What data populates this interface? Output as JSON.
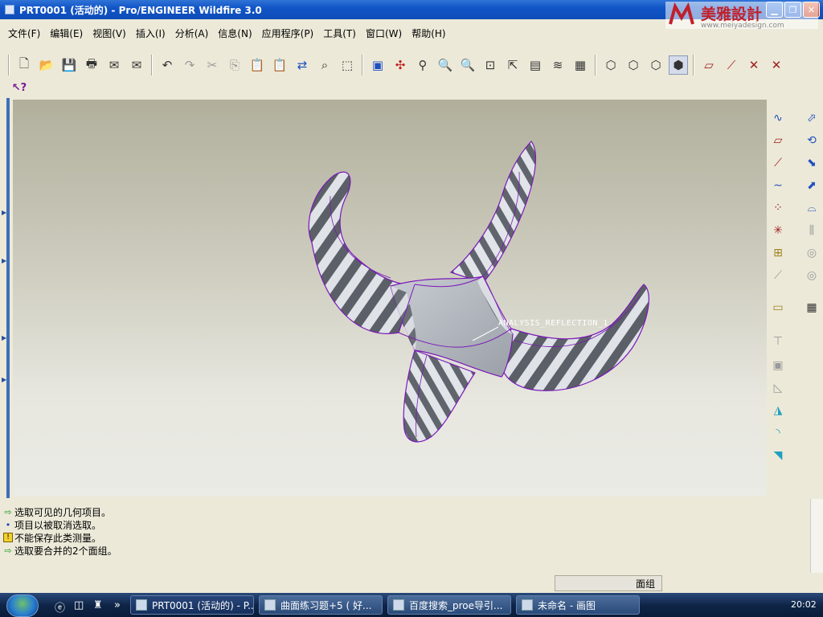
{
  "window": {
    "title": "PRT0001 (活动的) - Pro/ENGINEER Wildfire 3.0",
    "minimize": "▁",
    "restore": "❐",
    "close": "✕"
  },
  "menu": [
    "文件(F)",
    "编辑(E)",
    "视图(V)",
    "插入(I)",
    "分析(A)",
    "信息(N)",
    "应用程序(P)",
    "工具(T)",
    "窗口(W)",
    "帮助(H)"
  ],
  "toolbar_icons": [
    "new-file-icon",
    "open-folder-icon",
    "save-icon",
    "print-icon",
    "email-icon",
    "email-link-icon",
    "undo-icon",
    "redo-icon",
    "cut-icon",
    "copy-icon",
    "paste-icon",
    "paste-special-icon",
    "regenerate-icon",
    "find-icon",
    "select-box-icon",
    "redraw-icon",
    "spin-center-icon",
    "orient-icon",
    "zoom-in-icon",
    "zoom-out-icon",
    "refit-icon",
    "reorient-icon",
    "saved-views-icon",
    "layers-icon",
    "view-manager-icon",
    "wireframe-icon",
    "hidden-line-icon",
    "no-hidden-icon",
    "shading-icon",
    "datum-planes-icon",
    "datum-axes-icon",
    "datum-points-icon",
    "coord-sys-icon",
    "whats-this-icon"
  ],
  "viewport": {
    "annotation": "ANALYSIS_REFLECTION_1"
  },
  "messages": [
    {
      "icon": "arrow-icon",
      "text": "选取可见的几何项目。"
    },
    {
      "icon": "dot-icon",
      "text": "项目以被取消选取。"
    },
    {
      "icon": "warning-icon",
      "text": "不能保存此类测量。"
    },
    {
      "icon": "arrow-icon",
      "text": "选取要合并的2个面组。"
    }
  ],
  "status": {
    "filter_value": "面组"
  },
  "watermark": {
    "text": "美雅設計",
    "url": "www.meiyadesign.com"
  },
  "taskbar": {
    "tasks": [
      {
        "label": "PRT0001 (活动的) - P...",
        "active": true
      },
      {
        "label": "曲面练习题+5 ( 好...",
        "active": false
      },
      {
        "label": "百度搜索_proe导引...",
        "active": false
      },
      {
        "label": "未命名 - 画图",
        "active": false
      }
    ],
    "more": "»",
    "clock": "20:02"
  },
  "colors": {
    "accent": "#1255c7",
    "edges": "#7a18b8",
    "surface_light": "#d8dce0",
    "surface_dark": "#5a5e66"
  }
}
